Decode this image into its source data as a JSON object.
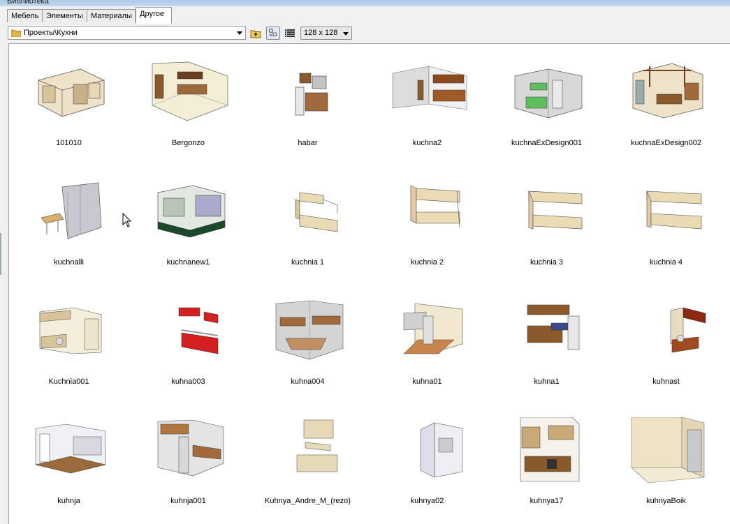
{
  "window": {
    "title": "Библиотека"
  },
  "tabs": [
    {
      "label": "Мебель",
      "active": false
    },
    {
      "label": "Элементы",
      "active": false
    },
    {
      "label": "Материалы",
      "active": false
    },
    {
      "label": "Другое",
      "active": true
    }
  ],
  "toolbar": {
    "path": "Проекты\\Кухни",
    "size_value": "128 x 128",
    "icons": [
      "folder-icon",
      "folder-up-icon",
      "thumbnail-view-icon",
      "details-view-icon",
      "chevron-down-icon"
    ]
  },
  "items": [
    {
      "label": "101010"
    },
    {
      "label": "Bergonzo"
    },
    {
      "label": "habar"
    },
    {
      "label": "kuchna2"
    },
    {
      "label": "kuchnaExDesign001"
    },
    {
      "label": "kuchnaExDesign002"
    },
    {
      "label": "kuchnalli"
    },
    {
      "label": "kuchnanew1"
    },
    {
      "label": "kuchnia 1"
    },
    {
      "label": "kuchnia 2"
    },
    {
      "label": "kuchnia 3"
    },
    {
      "label": "kuchnia 4"
    },
    {
      "label": "Kuchnia001"
    },
    {
      "label": "kuhna003"
    },
    {
      "label": "kuhna004"
    },
    {
      "label": "kuhna01"
    },
    {
      "label": "kuhna1"
    },
    {
      "label": "kuhnast"
    },
    {
      "label": "kuhnja"
    },
    {
      "label": "kuhnja001"
    },
    {
      "label": "Kuhnya_Andre_M_(rezo)"
    },
    {
      "label": "kuhnya02"
    },
    {
      "label": "kuhnya17"
    },
    {
      "label": "kuhnyaBoik"
    }
  ],
  "colors": {
    "title_bar": "#b9d2ec",
    "cabinet_wood": "#8b5a2b",
    "cabinet_cream": "#e6d9b8",
    "cabinet_red": "#d42020",
    "cabinet_green": "#5cbf5c",
    "wall_grey": "#d8d8d8",
    "floor_beige": "#efe6c4"
  }
}
